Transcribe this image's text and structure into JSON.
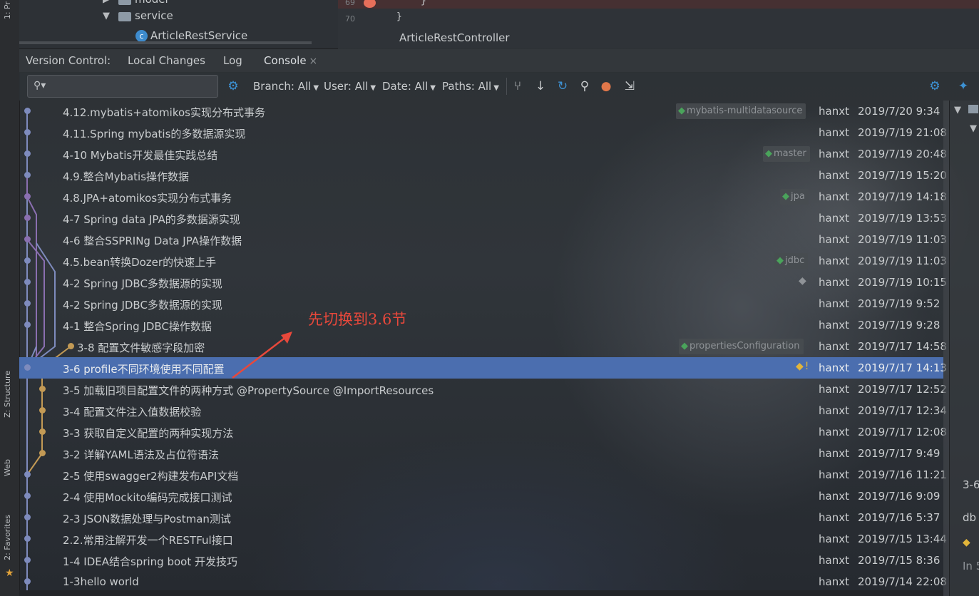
{
  "side_tabs": {
    "project": "1: Pr",
    "structure": "Z: Structure",
    "web": "Web",
    "favorites": "2: Favorites"
  },
  "project_tree": {
    "items": [
      {
        "label": "model",
        "kind": "folder",
        "expanded": false
      },
      {
        "label": "service",
        "kind": "folder",
        "expanded": true
      },
      {
        "label": "ArticleRestService",
        "kind": "class"
      }
    ]
  },
  "editor": {
    "line_69": "69",
    "line_70": "70",
    "code_69": "}",
    "code_70": "}",
    "breadcrumb": "ArticleRestController"
  },
  "vc_header": {
    "title": "Version Control:",
    "tabs": [
      "Local Changes",
      "Log",
      "Console"
    ],
    "close_icon": "×"
  },
  "toolbar": {
    "search_placeholder": "",
    "filters": [
      {
        "label": "Branch: All"
      },
      {
        "label": "User: All"
      },
      {
        "label": "Date: All"
      },
      {
        "label": "Paths: All"
      }
    ],
    "icons": [
      "settings-icon",
      "branch-graph-icon",
      "pull-icon",
      "refresh-icon",
      "search-icon",
      "cherry-pick-icon",
      "collapse-icon",
      "settings-icon",
      "pin-icon"
    ]
  },
  "log": {
    "commits": [
      {
        "subject": "4.12.mybatis+atomikos实现分布式事务",
        "author": "hanxt",
        "date": "2019/7/20 9:34",
        "tag": "mybatis-multidatasource"
      },
      {
        "subject": "4.11.Spring mybatis的多数据源实现",
        "author": "hanxt",
        "date": "2019/7/19 21:08"
      },
      {
        "subject": "4-10 Mybatis开发最佳实践总结",
        "author": "hanxt",
        "date": "2019/7/19 20:48",
        "tag": "master"
      },
      {
        "subject": "4.9.整合Mybatis操作数据",
        "author": "hanxt",
        "date": "2019/7/19 15:20"
      },
      {
        "subject": "4.8.JPA+atomikos实现分布式事务",
        "author": "hanxt",
        "date": "2019/7/19 14:18",
        "tag": "jpa"
      },
      {
        "subject": "4-7 Spring data JPA的多数据源实现",
        "author": "hanxt",
        "date": "2019/7/19 13:53"
      },
      {
        "subject": "4-6 整合SSPRINg Data JPA操作数据",
        "author": "hanxt",
        "date": "2019/7/19 11:03"
      },
      {
        "subject": "4.5.bean转换Dozer的快速上手",
        "author": "hanxt",
        "date": "2019/7/19 11:03",
        "tag": "jdbc"
      },
      {
        "subject": "4-2 Spring JDBC多数据源的实现",
        "author": "hanxt",
        "date": "2019/7/19 10:15",
        "tag_plain": true
      },
      {
        "subject": "4-2 Spring JDBC多数据源的实现",
        "author": "hanxt",
        "date": "2019/7/19 9:52"
      },
      {
        "subject": "4-1 整合Spring JDBC操作数据",
        "author": "hanxt",
        "date": "2019/7/19 9:28"
      },
      {
        "subject": "3-8 配置文件敏感字段加密",
        "author": "hanxt",
        "date": "2019/7/17 14:58",
        "tag": "propertiesConfiguration"
      },
      {
        "subject": "3-6 profile不同环境使用不同配置",
        "author": "hanxt",
        "date": "2019/7/17 14:13",
        "tag_warn": "!",
        "selected": true
      },
      {
        "subject": "3-5 加载旧项目配置文件的两种方式 @PropertySource @ImportResources",
        "author": "hanxt",
        "date": "2019/7/17 12:52"
      },
      {
        "subject": "3-4 配置文件注入值数据校验",
        "author": "hanxt",
        "date": "2019/7/17 12:34"
      },
      {
        "subject": "3-3 获取自定义配置的两种实现方法",
        "author": "hanxt",
        "date": "2019/7/17 12:08"
      },
      {
        "subject": "3-2 详解YAML语法及占位符语法",
        "author": "hanxt",
        "date": "2019/7/17 9:49"
      },
      {
        "subject": "2-5 使用swagger2构建发布API文档",
        "author": "hanxt",
        "date": "2019/7/16 11:21"
      },
      {
        "subject": "2-4 使用Mockito编码完成接口测试",
        "author": "hanxt",
        "date": "2019/7/16 9:09"
      },
      {
        "subject": "2-3 JSON数据处理与Postman测试",
        "author": "hanxt",
        "date": "2019/7/16 5:37"
      },
      {
        "subject": "2.2.常用注解开发一个RESTFul接口",
        "author": "hanxt",
        "date": "2019/7/15 13:44"
      },
      {
        "subject": "1-4 IDEA结合spring boot 开发技巧",
        "author": "hanxt",
        "date": "2019/7/15 8:36"
      },
      {
        "subject": "1-3hello world",
        "author": "hanxt",
        "date": "2019/7/14 22:08"
      }
    ]
  },
  "annotation": "先切换到3.6节",
  "right_panel": {
    "line1": "3-6",
    "line2": "db",
    "line3": "In 5"
  },
  "colors": {
    "selection": "#4b6eaf",
    "annotation": "#e8483b",
    "graph_blue": "#7e8bbd",
    "graph_purple": "#8a6fb0",
    "graph_orange": "#c39a55",
    "tag_green": "#4aa35b"
  }
}
